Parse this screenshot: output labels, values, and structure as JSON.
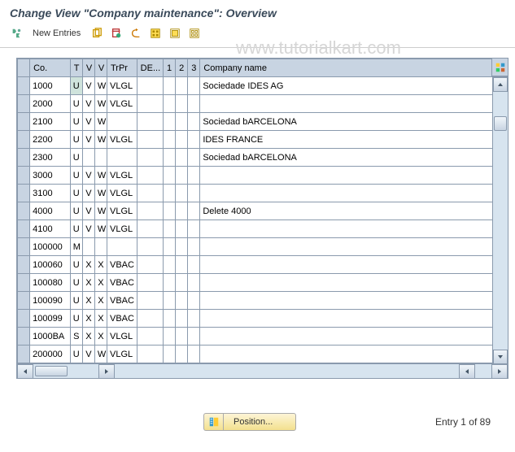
{
  "title": "Change View \"Company maintenance\": Overview",
  "watermark": "www.tutorialkart.com",
  "toolbar": {
    "new_entries": "New Entries"
  },
  "columns": {
    "co": "Co.",
    "t": "T",
    "v1": "V",
    "v2": "V",
    "trpr": "TrPr",
    "de": "DE...",
    "n1": "1",
    "n2": "2",
    "n3": "3",
    "name": "Company name"
  },
  "rows": [
    {
      "co": "1000",
      "t": "U",
      "v1": "V",
      "v2": "W",
      "trpr": "VLGL",
      "de": "",
      "n1": "",
      "n2": "",
      "n3": "",
      "name": "Sociedade IDES AG"
    },
    {
      "co": "2000",
      "t": "U",
      "v1": "V",
      "v2": "W",
      "trpr": "VLGL",
      "de": "",
      "n1": "",
      "n2": "",
      "n3": "",
      "name": ""
    },
    {
      "co": "2100",
      "t": "U",
      "v1": "V",
      "v2": "W",
      "trpr": "",
      "de": "",
      "n1": "",
      "n2": "",
      "n3": "",
      "name": "Sociedad bARCELONA"
    },
    {
      "co": "2200",
      "t": "U",
      "v1": "V",
      "v2": "W",
      "trpr": "VLGL",
      "de": "",
      "n1": "",
      "n2": "",
      "n3": "",
      "name": "IDES FRANCE"
    },
    {
      "co": "2300",
      "t": "U",
      "v1": "",
      "v2": "",
      "trpr": "",
      "de": "",
      "n1": "",
      "n2": "",
      "n3": "",
      "name": "Sociedad bARCELONA"
    },
    {
      "co": "3000",
      "t": "U",
      "v1": "V",
      "v2": "W",
      "trpr": "VLGL",
      "de": "",
      "n1": "",
      "n2": "",
      "n3": "",
      "name": ""
    },
    {
      "co": "3100",
      "t": "U",
      "v1": "V",
      "v2": "W",
      "trpr": "VLGL",
      "de": "",
      "n1": "",
      "n2": "",
      "n3": "",
      "name": ""
    },
    {
      "co": "4000",
      "t": "U",
      "v1": "V",
      "v2": "W",
      "trpr": "VLGL",
      "de": "",
      "n1": "",
      "n2": "",
      "n3": "",
      "name": "Delete 4000"
    },
    {
      "co": "4100",
      "t": "U",
      "v1": "V",
      "v2": "W",
      "trpr": "VLGL",
      "de": "",
      "n1": "",
      "n2": "",
      "n3": "",
      "name": ""
    },
    {
      "co": "100000",
      "t": "M",
      "v1": "",
      "v2": "",
      "trpr": "",
      "de": "",
      "n1": "",
      "n2": "",
      "n3": "",
      "name": ""
    },
    {
      "co": "100060",
      "t": "U",
      "v1": "X",
      "v2": "X",
      "trpr": "VBAC",
      "de": "",
      "n1": "",
      "n2": "",
      "n3": "",
      "name": ""
    },
    {
      "co": "100080",
      "t": "U",
      "v1": "X",
      "v2": "X",
      "trpr": "VBAC",
      "de": "",
      "n1": "",
      "n2": "",
      "n3": "",
      "name": ""
    },
    {
      "co": "100090",
      "t": "U",
      "v1": "X",
      "v2": "X",
      "trpr": "VBAC",
      "de": "",
      "n1": "",
      "n2": "",
      "n3": "",
      "name": ""
    },
    {
      "co": "100099",
      "t": "U",
      "v1": "X",
      "v2": "X",
      "trpr": "VBAC",
      "de": "",
      "n1": "",
      "n2": "",
      "n3": "",
      "name": ""
    },
    {
      "co": "1000BA",
      "t": "S",
      "v1": "X",
      "v2": "X",
      "trpr": "VLGL",
      "de": "",
      "n1": "",
      "n2": "",
      "n3": "",
      "name": ""
    },
    {
      "co": "200000",
      "t": "U",
      "v1": "V",
      "v2": "W",
      "trpr": "VLGL",
      "de": "",
      "n1": "",
      "n2": "",
      "n3": "",
      "name": ""
    }
  ],
  "footer": {
    "position_label": "Position...",
    "entry_text": "Entry 1 of 89"
  }
}
